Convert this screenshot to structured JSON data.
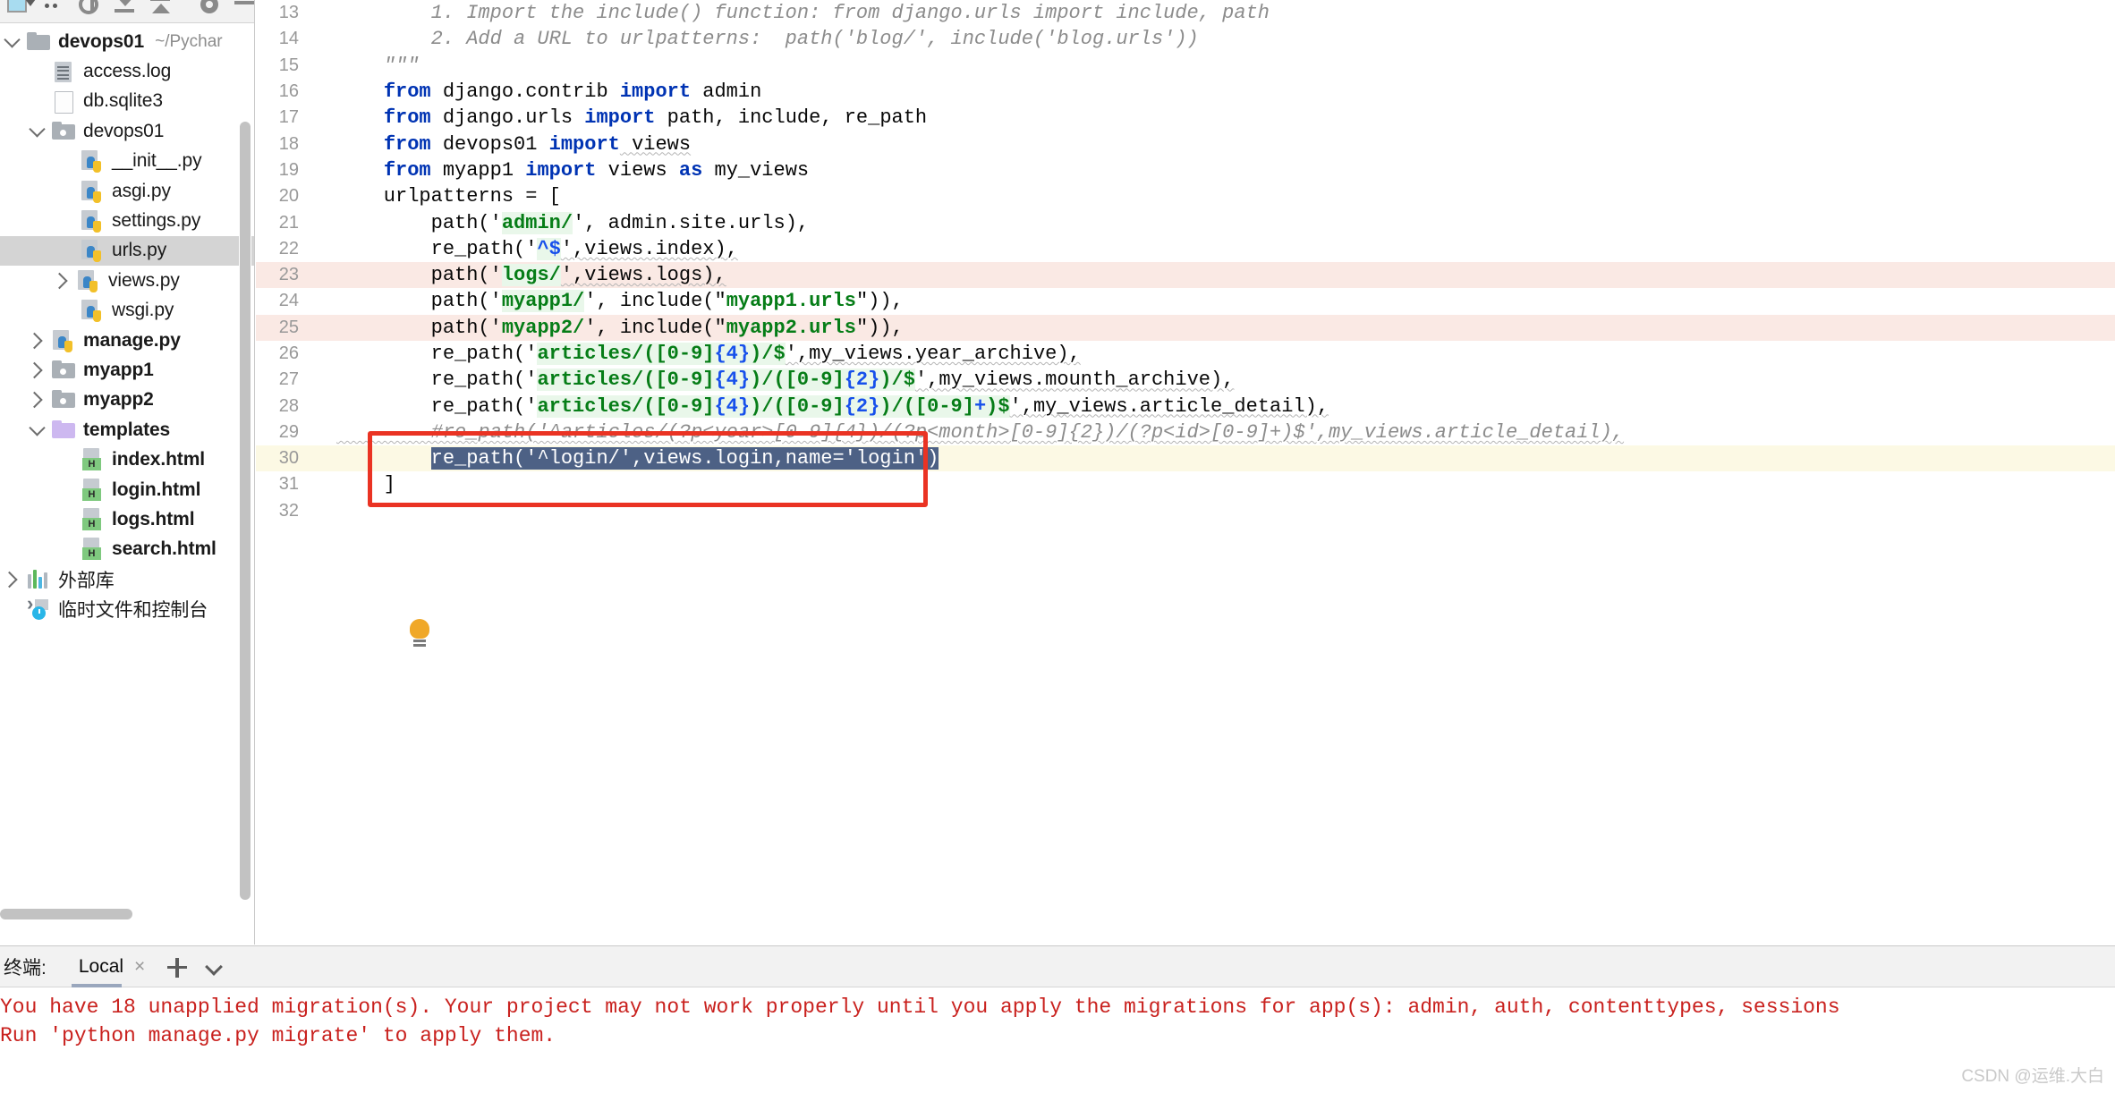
{
  "left_panel": {
    "toolbar_icons": [
      "preview-icon",
      "more-dots-icon",
      "target-icon",
      "collapse-all-icon",
      "expand-all-icon",
      "settings-gear-icon",
      "minimize-icon"
    ],
    "tree": [
      {
        "indent": 0,
        "twisty": "down",
        "icon": "folder-icon",
        "label": "devops01",
        "bold": true,
        "sublabel": "~/Pychar",
        "selected": false
      },
      {
        "indent": 1,
        "twisty": "none",
        "icon": "log-file-icon",
        "label": "access.log",
        "bold": false,
        "sublabel": "",
        "selected": false
      },
      {
        "indent": 1,
        "twisty": "none",
        "icon": "file-icon",
        "label": "db.sqlite3",
        "bold": false,
        "sublabel": "",
        "selected": false
      },
      {
        "indent": 1,
        "twisty": "down",
        "icon": "folder-icon",
        "label": "devops01",
        "bold": false,
        "sublabel": "",
        "selected": false
      },
      {
        "indent": 2,
        "twisty": "none",
        "icon": "python-file-icon",
        "label": "__init__.py",
        "bold": false,
        "sublabel": "",
        "selected": false
      },
      {
        "indent": 2,
        "twisty": "none",
        "icon": "python-file-icon",
        "label": "asgi.py",
        "bold": false,
        "sublabel": "",
        "selected": false
      },
      {
        "indent": 2,
        "twisty": "none",
        "icon": "python-file-icon",
        "label": "settings.py",
        "bold": false,
        "sublabel": "",
        "selected": false
      },
      {
        "indent": 2,
        "twisty": "none",
        "icon": "python-file-icon",
        "label": "urls.py",
        "bold": false,
        "sublabel": "",
        "selected": true
      },
      {
        "indent": 2,
        "twisty": "right",
        "icon": "python-file-icon",
        "label": "views.py",
        "bold": false,
        "sublabel": "",
        "selected": false
      },
      {
        "indent": 2,
        "twisty": "none",
        "icon": "python-file-icon",
        "label": "wsgi.py",
        "bold": false,
        "sublabel": "",
        "selected": false
      },
      {
        "indent": 1,
        "twisty": "right",
        "icon": "python-file-icon",
        "label": "manage.py",
        "bold": true,
        "sublabel": "",
        "selected": false
      },
      {
        "indent": 1,
        "twisty": "right",
        "icon": "folder-icon",
        "label": "myapp1",
        "bold": true,
        "sublabel": "",
        "selected": false
      },
      {
        "indent": 1,
        "twisty": "right",
        "icon": "folder-icon",
        "label": "myapp2",
        "bold": true,
        "sublabel": "",
        "selected": false
      },
      {
        "indent": 1,
        "twisty": "down",
        "icon": "folder-purple-icon",
        "label": "templates",
        "bold": true,
        "sublabel": "",
        "selected": false
      },
      {
        "indent": 2,
        "twisty": "none",
        "icon": "html-file-icon",
        "label": "index.html",
        "bold": true,
        "sublabel": "",
        "selected": false
      },
      {
        "indent": 2,
        "twisty": "none",
        "icon": "html-file-icon",
        "label": "login.html",
        "bold": true,
        "sublabel": "",
        "selected": false
      },
      {
        "indent": 2,
        "twisty": "none",
        "icon": "html-file-icon",
        "label": "logs.html",
        "bold": true,
        "sublabel": "",
        "selected": false
      },
      {
        "indent": 2,
        "twisty": "none",
        "icon": "html-file-icon",
        "label": "search.html",
        "bold": true,
        "sublabel": "",
        "selected": false
      },
      {
        "indent": 0,
        "twisty": "right",
        "icon": "external-libraries-icon",
        "label": "外部库",
        "bold": false,
        "sublabel": "",
        "selected": false
      },
      {
        "indent": 0,
        "twisty": "none",
        "icon": "scratches-icon",
        "label": "临时文件和控制台",
        "bold": false,
        "sublabel": "",
        "selected": false
      }
    ]
  },
  "editor": {
    "first_line_number": 13,
    "lines": [
      {
        "n": 13,
        "state": "normal"
      },
      {
        "n": 14,
        "state": "normal"
      },
      {
        "n": 15,
        "state": "normal"
      },
      {
        "n": 16,
        "state": "normal"
      },
      {
        "n": 17,
        "state": "normal"
      },
      {
        "n": 18,
        "state": "normal"
      },
      {
        "n": 19,
        "state": "normal"
      },
      {
        "n": 20,
        "state": "normal"
      },
      {
        "n": 21,
        "state": "normal"
      },
      {
        "n": 22,
        "state": "normal"
      },
      {
        "n": 23,
        "state": "error"
      },
      {
        "n": 24,
        "state": "normal"
      },
      {
        "n": 25,
        "state": "error"
      },
      {
        "n": 26,
        "state": "normal"
      },
      {
        "n": 27,
        "state": "normal"
      },
      {
        "n": 28,
        "state": "normal"
      },
      {
        "n": 29,
        "state": "normal"
      },
      {
        "n": 30,
        "state": "current"
      },
      {
        "n": 31,
        "state": "normal"
      },
      {
        "n": 32,
        "state": "normal"
      }
    ],
    "text": {
      "l13": "        1. Import the include() function: from django.urls import include, path",
      "l14": "        2. Add a URL to urlpatterns:  path('blog/', include('blog.urls'))",
      "l15": "    \"\"\"",
      "l16_kw1": "from",
      "l16_mid": " django.contrib ",
      "l16_kw2": "import",
      "l16_end": " admin",
      "l17_kw1": "from",
      "l17_mid": " django.urls ",
      "l17_kw2": "import",
      "l17_end": " path, include, re_path",
      "l18_kw1": "from",
      "l18_mid": " devops01 ",
      "l18_kw2": "import",
      "l18_end": " views",
      "l19_kw1": "from",
      "l19_mid": " myapp1 ",
      "l19_kw2": "import",
      "l19_mid2": " views ",
      "l19_kw3": "as",
      "l19_end": " my_views",
      "l20": "    urlpatterns = [",
      "l21_a": "        path('",
      "l21_s": "admin/",
      "l21_b": "', admin.site.urls),",
      "l22_a": "        re_path('",
      "l22_s": "^$",
      "l22_b": "',views.index),",
      "l23_a": "        path('",
      "l23_s": "logs/",
      "l23_b": "',views.logs),",
      "l24_a": "        path('",
      "l24_s": "myapp1/",
      "l24_b": "', include(\"",
      "l24_s2": "myapp1.urls",
      "l24_c": "\")),",
      "l25_a": "        path('",
      "l25_s": "myapp2/",
      "l25_b": "', include(\"",
      "l25_s2": "myapp2.urls",
      "l25_c": "\")),",
      "l26_a": "        re_path('",
      "l26_s1": "articles/([0-9]",
      "l26_n1": "{4}",
      "l26_s2": ")/$",
      "l26_b": "',my_views.year_archive),",
      "l27_a": "        re_path('",
      "l27_s1": "articles/([0-9]",
      "l27_n1": "{4}",
      "l27_s2": ")/([0-9]",
      "l27_n2": "{2}",
      "l27_s3": ")/$",
      "l27_b": "',my_views.mounth_archive),",
      "l28_a": "        re_path('",
      "l28_s1": "articles/([0-9]",
      "l28_n1": "{4}",
      "l28_s2": ")/([0-9]",
      "l28_n2": "{2}",
      "l28_s3": ")/([0-9]",
      "l28_n3": "+",
      "l28_s4": ")$",
      "l28_b": "',my_views.article_detail),",
      "l29": "        #re_path('^articles/(?p<year>[0-9]{4})/(?p<month>[0-9]{2})/(?p<id>[0-9]+)$',my_views.article_detail),",
      "l30_indent": "        ",
      "l30_sel": "re_path('^login/',views.login,name='login')",
      "l31": "    ]",
      "l32": ""
    },
    "annotation": {
      "type": "red-rectangle",
      "color": "#ea3323"
    },
    "gutter_bulb": "intention-bulb-icon"
  },
  "terminal": {
    "label": "终端:",
    "tab_name": "Local",
    "close_glyph": "×",
    "add_tab_icon": "plus-icon",
    "options_icon": "chevron-down-icon",
    "output": [
      "You have 18 unapplied migration(s). Your project may not work properly until you apply the migrations for app(s): admin, auth, contenttypes, sessions",
      "Run 'python manage.py migrate' to apply them."
    ]
  },
  "watermark": "CSDN @运维.大白"
}
